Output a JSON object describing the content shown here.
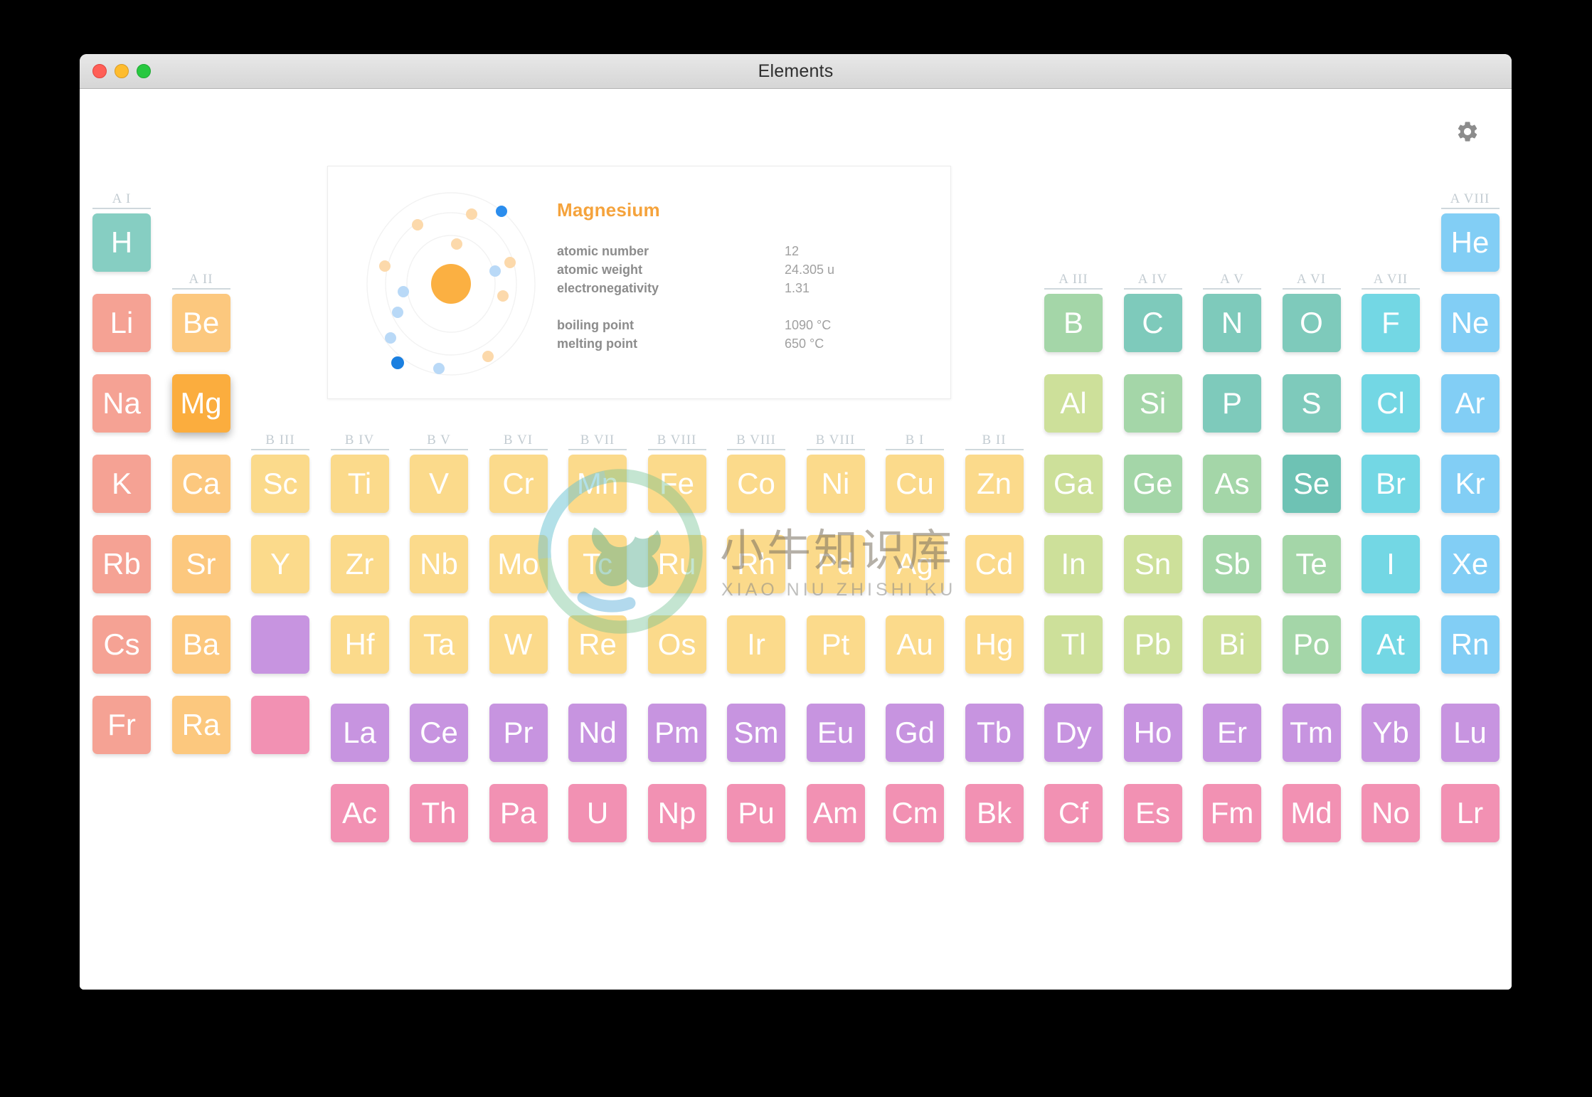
{
  "window": {
    "title": "Elements",
    "traffic_lights": [
      "close",
      "minimize",
      "maximize"
    ]
  },
  "toolbar": {
    "settings_icon": "gear-icon"
  },
  "info_card": {
    "element_name": "Magnesium",
    "atom_icon": "atom-diagram",
    "properties": [
      {
        "label": "atomic number",
        "value": "12"
      },
      {
        "label": "atomic weight",
        "value": "24.305 u"
      },
      {
        "label": "electronegativity",
        "value": "1.31"
      }
    ],
    "properties2": [
      {
        "label": "boiling point",
        "value": "1090 °C"
      },
      {
        "label": "melting point",
        "value": "650 °C"
      }
    ]
  },
  "watermark": {
    "chinese": "小牛知识库",
    "pinyin": "XIAO NIU ZHISHI KU",
    "logo_icon": "bull-circle-logo"
  },
  "colors": {
    "alkali": "#f5a294",
    "alkaline": "#fcc87e",
    "alkaline_sel": "#fbad3e",
    "transition": "#fbda8b",
    "hydrogen": "#86cec2",
    "metalloid_a": "#cde09a",
    "metalloid_b": "#a4d6a8",
    "nonmetal": "#7ecabb",
    "nonmetal_b": "#6ec2b4",
    "halogen": "#73d7e4",
    "noble": "#82cef5",
    "lanthanide": "#c794e0",
    "actinide": "#f291b3",
    "accent": "#f5a33c",
    "group_label": "#c3ccd2"
  },
  "group_headers": [
    {
      "label": "A I",
      "col": 1,
      "row": 1
    },
    {
      "label": "A II",
      "col": 2,
      "row": 2
    },
    {
      "label": "B III",
      "col": 3,
      "row": 4
    },
    {
      "label": "B IV",
      "col": 4,
      "row": 4
    },
    {
      "label": "B V",
      "col": 5,
      "row": 4
    },
    {
      "label": "B VI",
      "col": 6,
      "row": 4
    },
    {
      "label": "B VII",
      "col": 7,
      "row": 4
    },
    {
      "label": "B VIII",
      "col": 8,
      "row": 4
    },
    {
      "label": "B VIII",
      "col": 9,
      "row": 4
    },
    {
      "label": "B VIII",
      "col": 10,
      "row": 4
    },
    {
      "label": "B I",
      "col": 11,
      "row": 4
    },
    {
      "label": "B II",
      "col": 12,
      "row": 4
    },
    {
      "label": "A III",
      "col": 13,
      "row": 2
    },
    {
      "label": "A IV",
      "col": 14,
      "row": 2
    },
    {
      "label": "A V",
      "col": 15,
      "row": 2
    },
    {
      "label": "A VI",
      "col": 16,
      "row": 2
    },
    {
      "label": "A VII",
      "col": 17,
      "row": 2
    },
    {
      "label": "A VIII",
      "col": 18,
      "row": 1
    }
  ],
  "elements": [
    {
      "sym": "H",
      "col": 1,
      "row": 1,
      "color": "#86cec2"
    },
    {
      "sym": "He",
      "col": 18,
      "row": 1,
      "color": "#82cef5"
    },
    {
      "sym": "Li",
      "col": 1,
      "row": 2,
      "color": "#f5a294"
    },
    {
      "sym": "Be",
      "col": 2,
      "row": 2,
      "color": "#fcc87e"
    },
    {
      "sym": "B",
      "col": 13,
      "row": 2,
      "color": "#a4d6a8"
    },
    {
      "sym": "C",
      "col": 14,
      "row": 2,
      "color": "#7ecabb"
    },
    {
      "sym": "N",
      "col": 15,
      "row": 2,
      "color": "#7ecabb"
    },
    {
      "sym": "O",
      "col": 16,
      "row": 2,
      "color": "#7ecabb"
    },
    {
      "sym": "F",
      "col": 17,
      "row": 2,
      "color": "#73d7e4"
    },
    {
      "sym": "Ne",
      "col": 18,
      "row": 2,
      "color": "#82cef5"
    },
    {
      "sym": "Na",
      "col": 1,
      "row": 3,
      "color": "#f5a294"
    },
    {
      "sym": "Mg",
      "col": 2,
      "row": 3,
      "color": "#fbad3e",
      "selected": true
    },
    {
      "sym": "Al",
      "col": 13,
      "row": 3,
      "color": "#cde09a"
    },
    {
      "sym": "Si",
      "col": 14,
      "row": 3,
      "color": "#a4d6a8"
    },
    {
      "sym": "P",
      "col": 15,
      "row": 3,
      "color": "#7ecabb"
    },
    {
      "sym": "S",
      "col": 16,
      "row": 3,
      "color": "#7ecabb"
    },
    {
      "sym": "Cl",
      "col": 17,
      "row": 3,
      "color": "#73d7e4"
    },
    {
      "sym": "Ar",
      "col": 18,
      "row": 3,
      "color": "#82cef5"
    },
    {
      "sym": "K",
      "col": 1,
      "row": 4,
      "color": "#f5a294"
    },
    {
      "sym": "Ca",
      "col": 2,
      "row": 4,
      "color": "#fcc87e"
    },
    {
      "sym": "Sc",
      "col": 3,
      "row": 4,
      "color": "#fbda8b"
    },
    {
      "sym": "Ti",
      "col": 4,
      "row": 4,
      "color": "#fbda8b"
    },
    {
      "sym": "V",
      "col": 5,
      "row": 4,
      "color": "#fbda8b"
    },
    {
      "sym": "Cr",
      "col": 6,
      "row": 4,
      "color": "#fbda8b"
    },
    {
      "sym": "Mn",
      "col": 7,
      "row": 4,
      "color": "#fbda8b"
    },
    {
      "sym": "Fe",
      "col": 8,
      "row": 4,
      "color": "#fbda8b"
    },
    {
      "sym": "Co",
      "col": 9,
      "row": 4,
      "color": "#fbda8b"
    },
    {
      "sym": "Ni",
      "col": 10,
      "row": 4,
      "color": "#fbda8b"
    },
    {
      "sym": "Cu",
      "col": 11,
      "row": 4,
      "color": "#fbda8b"
    },
    {
      "sym": "Zn",
      "col": 12,
      "row": 4,
      "color": "#fbda8b"
    },
    {
      "sym": "Ga",
      "col": 13,
      "row": 4,
      "color": "#cde09a"
    },
    {
      "sym": "Ge",
      "col": 14,
      "row": 4,
      "color": "#a4d6a8"
    },
    {
      "sym": "As",
      "col": 15,
      "row": 4,
      "color": "#a4d6a8"
    },
    {
      "sym": "Se",
      "col": 16,
      "row": 4,
      "color": "#6ec2b4"
    },
    {
      "sym": "Br",
      "col": 17,
      "row": 4,
      "color": "#73d7e4"
    },
    {
      "sym": "Kr",
      "col": 18,
      "row": 4,
      "color": "#82cef5"
    },
    {
      "sym": "Rb",
      "col": 1,
      "row": 5,
      "color": "#f5a294"
    },
    {
      "sym": "Sr",
      "col": 2,
      "row": 5,
      "color": "#fcc87e"
    },
    {
      "sym": "Y",
      "col": 3,
      "row": 5,
      "color": "#fbda8b"
    },
    {
      "sym": "Zr",
      "col": 4,
      "row": 5,
      "color": "#fbda8b"
    },
    {
      "sym": "Nb",
      "col": 5,
      "row": 5,
      "color": "#fbda8b"
    },
    {
      "sym": "Mo",
      "col": 6,
      "row": 5,
      "color": "#fbda8b"
    },
    {
      "sym": "Tc",
      "col": 7,
      "row": 5,
      "color": "#fbda8b"
    },
    {
      "sym": "Ru",
      "col": 8,
      "row": 5,
      "color": "#fbda8b"
    },
    {
      "sym": "Rh",
      "col": 9,
      "row": 5,
      "color": "#fbda8b"
    },
    {
      "sym": "Pd",
      "col": 10,
      "row": 5,
      "color": "#fbda8b"
    },
    {
      "sym": "Ag",
      "col": 11,
      "row": 5,
      "color": "#fbda8b"
    },
    {
      "sym": "Cd",
      "col": 12,
      "row": 5,
      "color": "#fbda8b"
    },
    {
      "sym": "In",
      "col": 13,
      "row": 5,
      "color": "#cde09a"
    },
    {
      "sym": "Sn",
      "col": 14,
      "row": 5,
      "color": "#cde09a"
    },
    {
      "sym": "Sb",
      "col": 15,
      "row": 5,
      "color": "#a4d6a8"
    },
    {
      "sym": "Te",
      "col": 16,
      "row": 5,
      "color": "#a4d6a8"
    },
    {
      "sym": "I",
      "col": 17,
      "row": 5,
      "color": "#73d7e4"
    },
    {
      "sym": "Xe",
      "col": 18,
      "row": 5,
      "color": "#82cef5"
    },
    {
      "sym": "Cs",
      "col": 1,
      "row": 6,
      "color": "#f5a294"
    },
    {
      "sym": "Ba",
      "col": 2,
      "row": 6,
      "color": "#fcc87e"
    },
    {
      "sym": "",
      "col": 3,
      "row": 6,
      "color": "#c794e0",
      "empty": true
    },
    {
      "sym": "Hf",
      "col": 4,
      "row": 6,
      "color": "#fbda8b"
    },
    {
      "sym": "Ta",
      "col": 5,
      "row": 6,
      "color": "#fbda8b"
    },
    {
      "sym": "W",
      "col": 6,
      "row": 6,
      "color": "#fbda8b"
    },
    {
      "sym": "Re",
      "col": 7,
      "row": 6,
      "color": "#fbda8b"
    },
    {
      "sym": "Os",
      "col": 8,
      "row": 6,
      "color": "#fbda8b"
    },
    {
      "sym": "Ir",
      "col": 9,
      "row": 6,
      "color": "#fbda8b"
    },
    {
      "sym": "Pt",
      "col": 10,
      "row": 6,
      "color": "#fbda8b"
    },
    {
      "sym": "Au",
      "col": 11,
      "row": 6,
      "color": "#fbda8b"
    },
    {
      "sym": "Hg",
      "col": 12,
      "row": 6,
      "color": "#fbda8b"
    },
    {
      "sym": "Tl",
      "col": 13,
      "row": 6,
      "color": "#cde09a"
    },
    {
      "sym": "Pb",
      "col": 14,
      "row": 6,
      "color": "#cde09a"
    },
    {
      "sym": "Bi",
      "col": 15,
      "row": 6,
      "color": "#cde09a"
    },
    {
      "sym": "Po",
      "col": 16,
      "row": 6,
      "color": "#a4d6a8"
    },
    {
      "sym": "At",
      "col": 17,
      "row": 6,
      "color": "#73d7e4"
    },
    {
      "sym": "Rn",
      "col": 18,
      "row": 6,
      "color": "#82cef5"
    },
    {
      "sym": "Fr",
      "col": 1,
      "row": 7,
      "color": "#f5a294"
    },
    {
      "sym": "Ra",
      "col": 2,
      "row": 7,
      "color": "#fcc87e"
    },
    {
      "sym": "",
      "col": 3,
      "row": 7,
      "color": "#f291b3",
      "empty": true
    }
  ],
  "lanthanides": [
    {
      "sym": "La",
      "col": 4
    },
    {
      "sym": "Ce",
      "col": 5
    },
    {
      "sym": "Pr",
      "col": 6
    },
    {
      "sym": "Nd",
      "col": 7
    },
    {
      "sym": "Pm",
      "col": 8
    },
    {
      "sym": "Sm",
      "col": 9
    },
    {
      "sym": "Eu",
      "col": 10
    },
    {
      "sym": "Gd",
      "col": 11
    },
    {
      "sym": "Tb",
      "col": 12
    },
    {
      "sym": "Dy",
      "col": 13
    },
    {
      "sym": "Ho",
      "col": 14
    },
    {
      "sym": "Er",
      "col": 15
    },
    {
      "sym": "Tm",
      "col": 16
    },
    {
      "sym": "Yb",
      "col": 17
    },
    {
      "sym": "Lu",
      "col": 18
    }
  ],
  "actinides": [
    {
      "sym": "Ac",
      "col": 4
    },
    {
      "sym": "Th",
      "col": 5
    },
    {
      "sym": "Pa",
      "col": 6
    },
    {
      "sym": "U",
      "col": 7
    },
    {
      "sym": "Np",
      "col": 8
    },
    {
      "sym": "Pu",
      "col": 9
    },
    {
      "sym": "Am",
      "col": 10
    },
    {
      "sym": "Cm",
      "col": 11
    },
    {
      "sym": "Bk",
      "col": 12
    },
    {
      "sym": "Cf",
      "col": 13
    },
    {
      "sym": "Es",
      "col": 14
    },
    {
      "sym": "Fm",
      "col": 15
    },
    {
      "sym": "Md",
      "col": 16
    },
    {
      "sym": "No",
      "col": 17
    },
    {
      "sym": "Lr",
      "col": 18
    }
  ]
}
